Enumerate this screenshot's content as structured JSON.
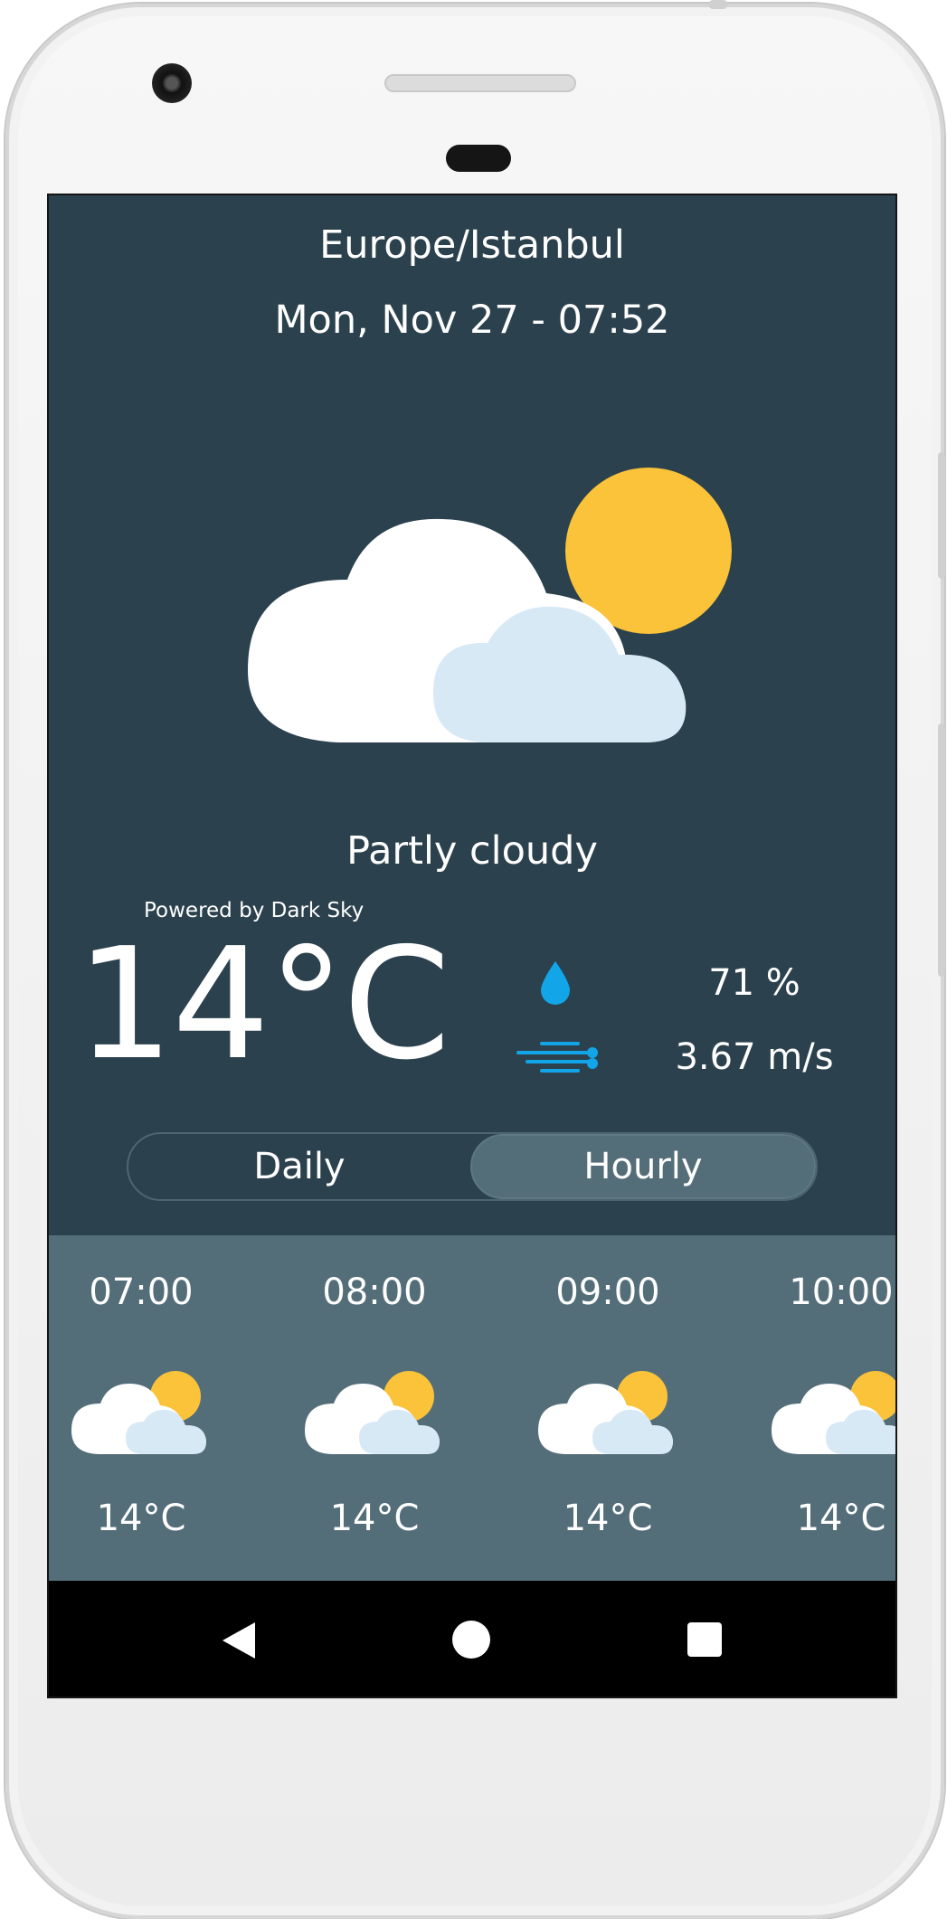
{
  "header": {
    "timezone": "Europe/Istanbul",
    "datetime": "Mon, Nov 27 - 07:52"
  },
  "current": {
    "icon": "partly-cloudy-day-icon",
    "summary": "Partly cloudy",
    "attribution": "Powered by Dark Sky",
    "temperature": "14°C",
    "humidity": "71 %",
    "wind_speed": "3.67 m/s"
  },
  "toggle": {
    "daily_label": "Daily",
    "hourly_label": "Hourly",
    "selected": "Hourly"
  },
  "hourly": [
    {
      "time": "07:00",
      "icon": "partly-cloudy-day-icon",
      "temp": "14°C"
    },
    {
      "time": "08:00",
      "icon": "partly-cloudy-day-icon",
      "temp": "14°C"
    },
    {
      "time": "09:00",
      "icon": "partly-cloudy-day-icon",
      "temp": "14°C"
    },
    {
      "time": "10:00",
      "icon": "partly-cloudy-day-icon",
      "temp": "14°C"
    }
  ],
  "colors": {
    "background": "#2b414d",
    "hourly_panel": "#546e79",
    "accent_blue": "#12a5e8",
    "sun": "#fbc33a",
    "cloud_front": "#d8e9f6"
  }
}
